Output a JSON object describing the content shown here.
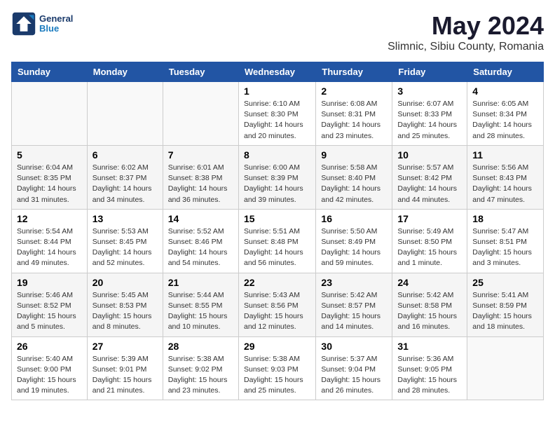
{
  "logo": {
    "line1": "General",
    "line2": "Blue"
  },
  "title": "May 2024",
  "subtitle": "Slimnic, Sibiu County, Romania",
  "headers": [
    "Sunday",
    "Monday",
    "Tuesday",
    "Wednesday",
    "Thursday",
    "Friday",
    "Saturday"
  ],
  "weeks": [
    [
      {
        "day": "",
        "info": ""
      },
      {
        "day": "",
        "info": ""
      },
      {
        "day": "",
        "info": ""
      },
      {
        "day": "1",
        "info": "Sunrise: 6:10 AM\nSunset: 8:30 PM\nDaylight: 14 hours\nand 20 minutes."
      },
      {
        "day": "2",
        "info": "Sunrise: 6:08 AM\nSunset: 8:31 PM\nDaylight: 14 hours\nand 23 minutes."
      },
      {
        "day": "3",
        "info": "Sunrise: 6:07 AM\nSunset: 8:33 PM\nDaylight: 14 hours\nand 25 minutes."
      },
      {
        "day": "4",
        "info": "Sunrise: 6:05 AM\nSunset: 8:34 PM\nDaylight: 14 hours\nand 28 minutes."
      }
    ],
    [
      {
        "day": "5",
        "info": "Sunrise: 6:04 AM\nSunset: 8:35 PM\nDaylight: 14 hours\nand 31 minutes."
      },
      {
        "day": "6",
        "info": "Sunrise: 6:02 AM\nSunset: 8:37 PM\nDaylight: 14 hours\nand 34 minutes."
      },
      {
        "day": "7",
        "info": "Sunrise: 6:01 AM\nSunset: 8:38 PM\nDaylight: 14 hours\nand 36 minutes."
      },
      {
        "day": "8",
        "info": "Sunrise: 6:00 AM\nSunset: 8:39 PM\nDaylight: 14 hours\nand 39 minutes."
      },
      {
        "day": "9",
        "info": "Sunrise: 5:58 AM\nSunset: 8:40 PM\nDaylight: 14 hours\nand 42 minutes."
      },
      {
        "day": "10",
        "info": "Sunrise: 5:57 AM\nSunset: 8:42 PM\nDaylight: 14 hours\nand 44 minutes."
      },
      {
        "day": "11",
        "info": "Sunrise: 5:56 AM\nSunset: 8:43 PM\nDaylight: 14 hours\nand 47 minutes."
      }
    ],
    [
      {
        "day": "12",
        "info": "Sunrise: 5:54 AM\nSunset: 8:44 PM\nDaylight: 14 hours\nand 49 minutes."
      },
      {
        "day": "13",
        "info": "Sunrise: 5:53 AM\nSunset: 8:45 PM\nDaylight: 14 hours\nand 52 minutes."
      },
      {
        "day": "14",
        "info": "Sunrise: 5:52 AM\nSunset: 8:46 PM\nDaylight: 14 hours\nand 54 minutes."
      },
      {
        "day": "15",
        "info": "Sunrise: 5:51 AM\nSunset: 8:48 PM\nDaylight: 14 hours\nand 56 minutes."
      },
      {
        "day": "16",
        "info": "Sunrise: 5:50 AM\nSunset: 8:49 PM\nDaylight: 14 hours\nand 59 minutes."
      },
      {
        "day": "17",
        "info": "Sunrise: 5:49 AM\nSunset: 8:50 PM\nDaylight: 15 hours\nand 1 minute."
      },
      {
        "day": "18",
        "info": "Sunrise: 5:47 AM\nSunset: 8:51 PM\nDaylight: 15 hours\nand 3 minutes."
      }
    ],
    [
      {
        "day": "19",
        "info": "Sunrise: 5:46 AM\nSunset: 8:52 PM\nDaylight: 15 hours\nand 5 minutes."
      },
      {
        "day": "20",
        "info": "Sunrise: 5:45 AM\nSunset: 8:53 PM\nDaylight: 15 hours\nand 8 minutes."
      },
      {
        "day": "21",
        "info": "Sunrise: 5:44 AM\nSunset: 8:55 PM\nDaylight: 15 hours\nand 10 minutes."
      },
      {
        "day": "22",
        "info": "Sunrise: 5:43 AM\nSunset: 8:56 PM\nDaylight: 15 hours\nand 12 minutes."
      },
      {
        "day": "23",
        "info": "Sunrise: 5:42 AM\nSunset: 8:57 PM\nDaylight: 15 hours\nand 14 minutes."
      },
      {
        "day": "24",
        "info": "Sunrise: 5:42 AM\nSunset: 8:58 PM\nDaylight: 15 hours\nand 16 minutes."
      },
      {
        "day": "25",
        "info": "Sunrise: 5:41 AM\nSunset: 8:59 PM\nDaylight: 15 hours\nand 18 minutes."
      }
    ],
    [
      {
        "day": "26",
        "info": "Sunrise: 5:40 AM\nSunset: 9:00 PM\nDaylight: 15 hours\nand 19 minutes."
      },
      {
        "day": "27",
        "info": "Sunrise: 5:39 AM\nSunset: 9:01 PM\nDaylight: 15 hours\nand 21 minutes."
      },
      {
        "day": "28",
        "info": "Sunrise: 5:38 AM\nSunset: 9:02 PM\nDaylight: 15 hours\nand 23 minutes."
      },
      {
        "day": "29",
        "info": "Sunrise: 5:38 AM\nSunset: 9:03 PM\nDaylight: 15 hours\nand 25 minutes."
      },
      {
        "day": "30",
        "info": "Sunrise: 5:37 AM\nSunset: 9:04 PM\nDaylight: 15 hours\nand 26 minutes."
      },
      {
        "day": "31",
        "info": "Sunrise: 5:36 AM\nSunset: 9:05 PM\nDaylight: 15 hours\nand 28 minutes."
      },
      {
        "day": "",
        "info": ""
      }
    ]
  ]
}
